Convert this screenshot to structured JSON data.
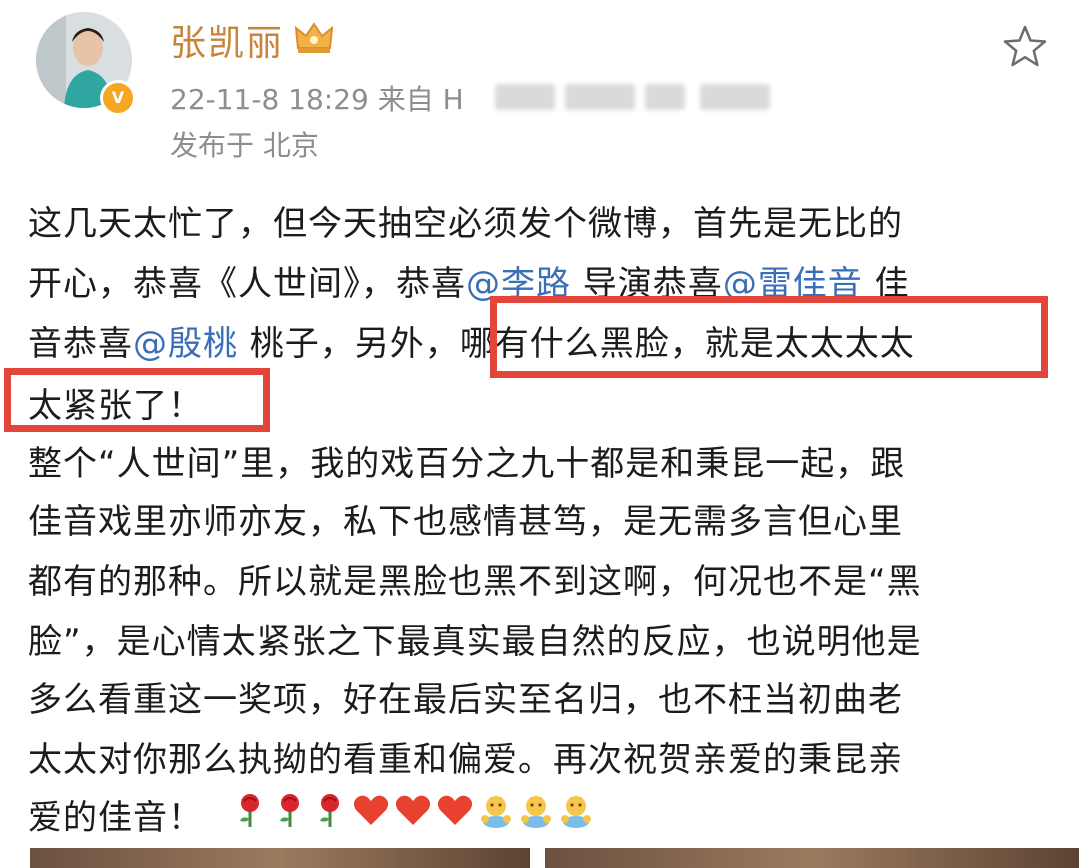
{
  "post": {
    "username": "张凯丽",
    "meta_prefix": "22-11-8 18:29   来自 H",
    "location": "发布于 北京",
    "lines": [
      "这几天太忙了，但今天抽空必须发个微博，首先是无比的",
      "开心，恭喜《人世间》，恭喜",
      "音恭喜",
      "太紧张了！",
      "整个“人世间”里，我的戏百分之九十都是和秉昆一起，跟",
      "佳音戏里亦师亦友，私下也感情甚笃，是无需多言但心里",
      "都有的那种。所以就是黑脸也黑不到这啊，何况也不是“黑",
      "脸”，是心情太紧张之下最真实最自然的反应，也说明他是",
      "多么看重这一奖项，好在最后实至名归，也不枉当初曲老",
      "太太对你那么执拗的看重和偏爱。再次祝贺亲爱的秉昆亲",
      "爱的佳音！"
    ],
    "mention_1": "@李路",
    "line2_mid": " 导演恭喜",
    "mention_2": "@雷佳音",
    "line2_end": " 佳",
    "mention_3": "@殷桃",
    "line3_mid": " 桃子，另外，",
    "highlight_text": "哪有什么黑脸，就是太太太太"
  },
  "icons": {
    "avatar": "avatar-photo",
    "verified": "verified-badge-icon",
    "crown": "crown-icon",
    "favorite": "star-icon",
    "emoji": [
      "rose-icon",
      "rose-icon",
      "rose-icon",
      "heart-icon",
      "heart-icon",
      "heart-icon",
      "hug-icon",
      "hug-icon",
      "hug-icon"
    ]
  },
  "colors": {
    "username": "#c8843a",
    "mention": "#3a6fb7",
    "highlight_border": "#e2453a",
    "meta": "#8e8e8e"
  }
}
